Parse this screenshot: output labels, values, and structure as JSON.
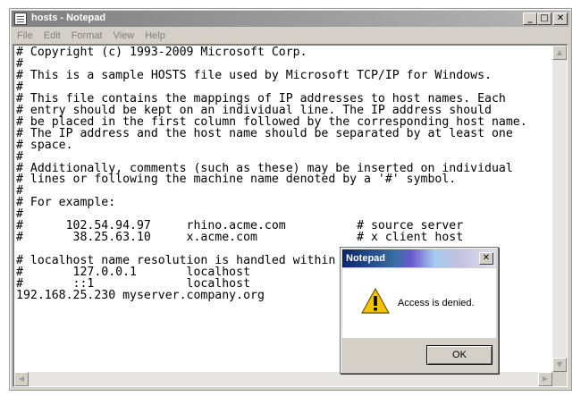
{
  "window": {
    "title": "hosts - Notepad",
    "buttons": {
      "minimize": "_",
      "maximize": "□",
      "close": "✕"
    }
  },
  "menu": [
    "File",
    "Edit",
    "Format",
    "View",
    "Help"
  ],
  "editor": {
    "lines": [
      "# Copyright (c) 1993-2009 Microsoft Corp.",
      "#",
      "# This is a sample HOSTS file used by Microsoft TCP/IP for Windows.",
      "#",
      "# This file contains the mappings of IP addresses to host names. Each",
      "# entry should be kept on an individual line. The IP address should",
      "# be placed in the first column followed by the corresponding host name.",
      "# The IP address and the host name should be separated by at least one",
      "# space.",
      "#",
      "# Additionally, comments (such as these) may be inserted on individual",
      "# lines or following the machine name denoted by a '#' symbol.",
      "#",
      "# For example:",
      "#",
      "#      102.54.94.97     rhino.acme.com          # source server",
      "#       38.25.63.10     x.acme.com              # x client host",
      "",
      "# localhost name resolution is handled within DNS itself.",
      "#       127.0.0.1       localhost",
      "#       ::1             localhost",
      "192.168.25.230 myserver.company.org"
    ]
  },
  "dialog": {
    "title": "Notepad",
    "close": "✕",
    "message": "Access is denied.",
    "ok_label": "OK",
    "icon": "warning-icon"
  }
}
